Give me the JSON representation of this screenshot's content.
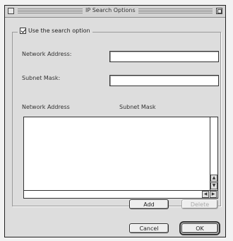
{
  "window": {
    "title": "IP Search Options"
  },
  "search_option": {
    "label": "Use the search option",
    "checked": true
  },
  "fields": {
    "network_address_label": "Network Address:",
    "subnet_mask_label": "Subnet Mask:",
    "network_address_value": "",
    "subnet_mask_value": ""
  },
  "list": {
    "columns": [
      "Network Address",
      "Subnet Mask"
    ],
    "rows": []
  },
  "buttons": {
    "add": "Add",
    "delete": "Delete",
    "cancel": "Cancel",
    "ok": "OK"
  },
  "icons": {
    "close": "close-box-icon",
    "zoom": "zoom-box-icon",
    "scroll_up": "▲",
    "scroll_down": "▼",
    "scroll_left": "◀",
    "scroll_right": "▶"
  }
}
